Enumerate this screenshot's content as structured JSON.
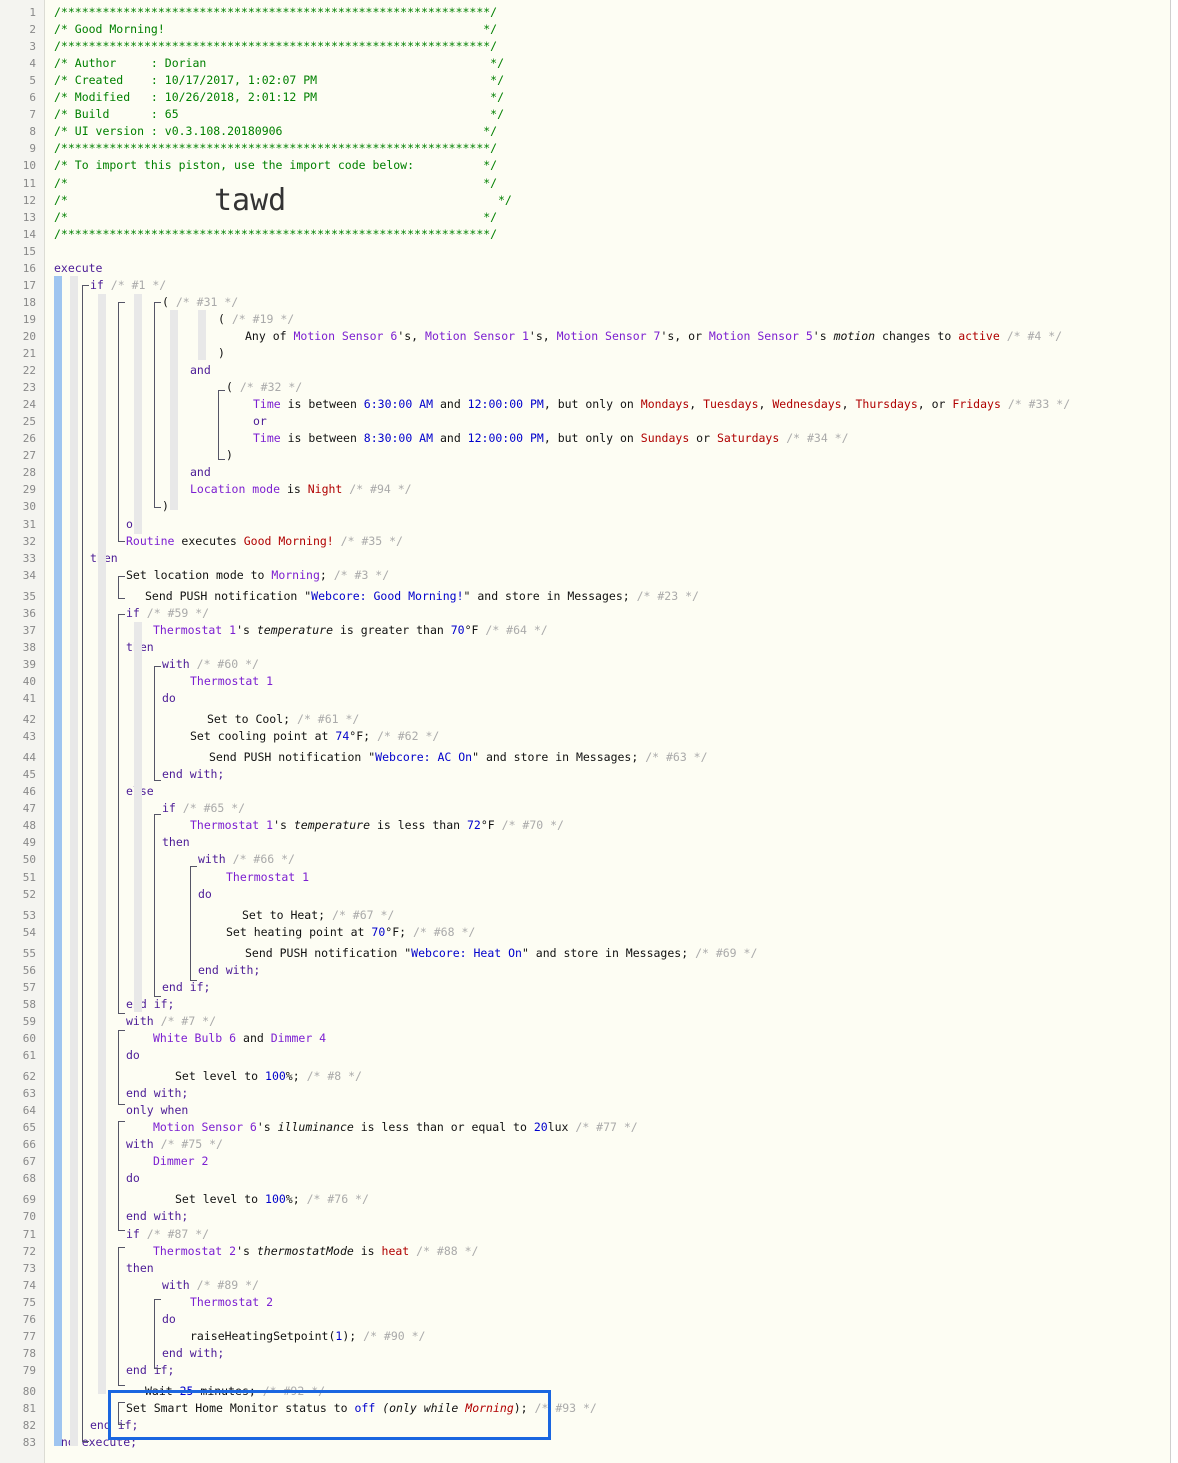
{
  "line_numbers": [
    "1",
    "2",
    "3",
    "4",
    "5",
    "6",
    "7",
    "8",
    "9",
    "10",
    "11",
    "12",
    "13",
    "14",
    "15",
    "16",
    "17",
    "18",
    "19",
    "20",
    "21",
    "22",
    "23",
    "24",
    "25",
    "26",
    "27",
    "28",
    "29",
    "30",
    "31",
    "32",
    "33",
    "34",
    "35",
    "36",
    "37",
    "38",
    "39",
    "40",
    "41",
    "42",
    "43",
    "44",
    "45",
    "46",
    "47",
    "48",
    "49",
    "50",
    "51",
    "52",
    "53",
    "54",
    "55",
    "56",
    "57",
    "58",
    "59",
    "60",
    "61",
    "62",
    "63",
    "64",
    "65",
    "66",
    "67",
    "68",
    "69",
    "70",
    "71",
    "72",
    "73",
    "74",
    "75",
    "76",
    "77",
    "78",
    "79",
    "80",
    "81",
    "82",
    "83"
  ],
  "header": {
    "stars": "/**************************************************************/",
    "title_line": "/* Good Morning!                                              */",
    "author_line": "/* Author     : Dorian                                         */",
    "created_line": "/* Created    : 10/17/2017, 1:02:07 PM                         */",
    "modified_line": "/* Modified   : 10/26/2018, 2:01:12 PM                         */",
    "build_line": "/* Build      : 65                                             */",
    "ui_line": "/* UI version : v0.3.108.20180906                             */",
    "import_line": "/* To import this piston, use the import code below:          */",
    "blank_line": "/*                                                            */",
    "import_code_prefix": "/*",
    "import_code_suffix": "*/",
    "import_code": "tawd"
  },
  "code": {
    "execute": "execute",
    "end_execute": "end execute;",
    "if": "if",
    "then": "then",
    "else": "else",
    "and": "and",
    "or": "or",
    "with": "with",
    "do": "do",
    "end_with": "end with;",
    "end_if": "end if;",
    "only_when": "only when",
    "open_paren": "(",
    "close_paren": ")",
    "c1": "/* #1 */",
    "c31": "/* #31 */",
    "c19": "/* #19 */",
    "line20": {
      "any_of": "Any of ",
      "d1": "Motion Sensor 6",
      "s1": "'s, ",
      "d2": "Motion Sensor 1",
      "s2": "'s, ",
      "d3": "Motion Sensor 7",
      "s3": "'s, or ",
      "d4": "Motion Sensor 5",
      "s4": "'s ",
      "attr": "motion",
      "changes": " changes to ",
      "value": "active",
      "comment": "/* #4 */"
    },
    "c32": "/* #32 */",
    "line24": {
      "time": "Time",
      "is_between": " is between ",
      "t1": "6:30:00 AM",
      "and_word": " and ",
      "t2": "12:00:00 PM",
      "but": ", but only on ",
      "days": [
        "Mondays",
        "Tuesdays",
        "Wednesdays",
        "Thursdays",
        "Fridays"
      ],
      "comma": ", ",
      "or_word": ", or ",
      "comment": "/* #33 */"
    },
    "line26": {
      "time": "Time",
      "is_between": " is between ",
      "t1": "8:30:00 AM",
      "and_word": " and ",
      "t2": "12:00:00 PM",
      "but": ", but only on ",
      "d1": "Sundays",
      "or_word": " or ",
      "d2": "Saturdays",
      "comment": "/* #34 */"
    },
    "line29": {
      "dev": "Location mode",
      "is": " is ",
      "value": "Night",
      "comment": "/* #94 */"
    },
    "line32": {
      "dev": "Routine",
      "executes": " executes ",
      "value": "Good Morning!",
      "comment": "/* #35 */"
    },
    "line34": {
      "text": "Set location mode to ",
      "value": "Morning",
      "end": ";",
      "comment": "/* #3 */"
    },
    "line35": {
      "text": "Send PUSH notification \"",
      "msg": "Webcore: Good Morning!",
      "end": "\" and store in Messages;",
      "comment": "/* #23 */"
    },
    "c59": "/* #59 */",
    "line37": {
      "dev": "Thermostat 1",
      "s": "'s ",
      "attr": "temperature",
      "cmp": " is greater than ",
      "num": "70",
      "unit": "°F",
      "comment": "/* #64 */"
    },
    "c60": "/* #60 */",
    "therm1": "Thermostat 1",
    "line42": {
      "text": "Set to Cool;",
      "comment": "/* #61 */"
    },
    "line43": {
      "text": "Set cooling point at ",
      "num": "74",
      "end": "°F;",
      "comment": "/* #62 */"
    },
    "line44": {
      "text": "Send PUSH notification \"",
      "msg": "Webcore: AC On",
      "end": "\" and store in Messages;",
      "comment": "/* #63 */"
    },
    "c65": "/* #65 */",
    "line48": {
      "dev": "Thermostat 1",
      "s": "'s ",
      "attr": "temperature",
      "cmp": " is less than ",
      "num": "72",
      "unit": "°F",
      "comment": "/* #70 */"
    },
    "c66": "/* #66 */",
    "line53": {
      "text": "Set to Heat;",
      "comment": "/* #67 */"
    },
    "line54": {
      "text": "Set heating point at ",
      "num": "70",
      "end": "°F;",
      "comment": "/* #68 */"
    },
    "line55": {
      "text": "Send PUSH notification \"",
      "msg": "Webcore: Heat On",
      "end": "\" and store in Messages;",
      "comment": "/* #69 */"
    },
    "c7": "/* #7 */",
    "line60": {
      "d1": "White Bulb 6",
      "and_word": " and ",
      "d2": "Dimmer 4"
    },
    "line62": {
      "text": "Set level to ",
      "num": "100",
      "end": "%;",
      "comment": "/* #8 */"
    },
    "line65": {
      "dev": "Motion Sensor 6",
      "s": "'s ",
      "attr": "illuminance",
      "cmp": " is less than or equal to ",
      "num": "20",
      "unit": "lux",
      "comment": "/* #77 */"
    },
    "c75": "/* #75 */",
    "dimmer2": "Dimmer 2",
    "line69": {
      "text": "Set level to ",
      "num": "100",
      "end": "%;",
      "comment": "/* #76 */"
    },
    "c87": "/* #87 */",
    "line72": {
      "dev": "Thermostat 2",
      "s": "'s ",
      "attr": "thermostatMode",
      "is": " is ",
      "value": "heat",
      "comment": "/* #88 */"
    },
    "c89": "/* #89 */",
    "therm2": "Thermostat 2",
    "line77": {
      "fn": "raiseHeatingSetpoint(",
      "num": "1",
      "end": ");",
      "comment": "/* #90 */"
    },
    "line80": {
      "text": "Wait ",
      "num": "25",
      "end": " minutes;",
      "comment": "/* #92 */"
    },
    "line81": {
      "text": "Set Smart Home Monitor status to ",
      "value": "off",
      "paren": " (only while ",
      "mode": "Morning",
      "close": ");",
      "comment": "/* #93 */"
    },
    "end_if_82": "end if;"
  },
  "colors": {
    "accent_highlight": "#1a66e0",
    "comment_green": "#008000",
    "device_purple": "#7c1fd1",
    "value_red": "#b00000",
    "number_blue": "#0000cc"
  }
}
